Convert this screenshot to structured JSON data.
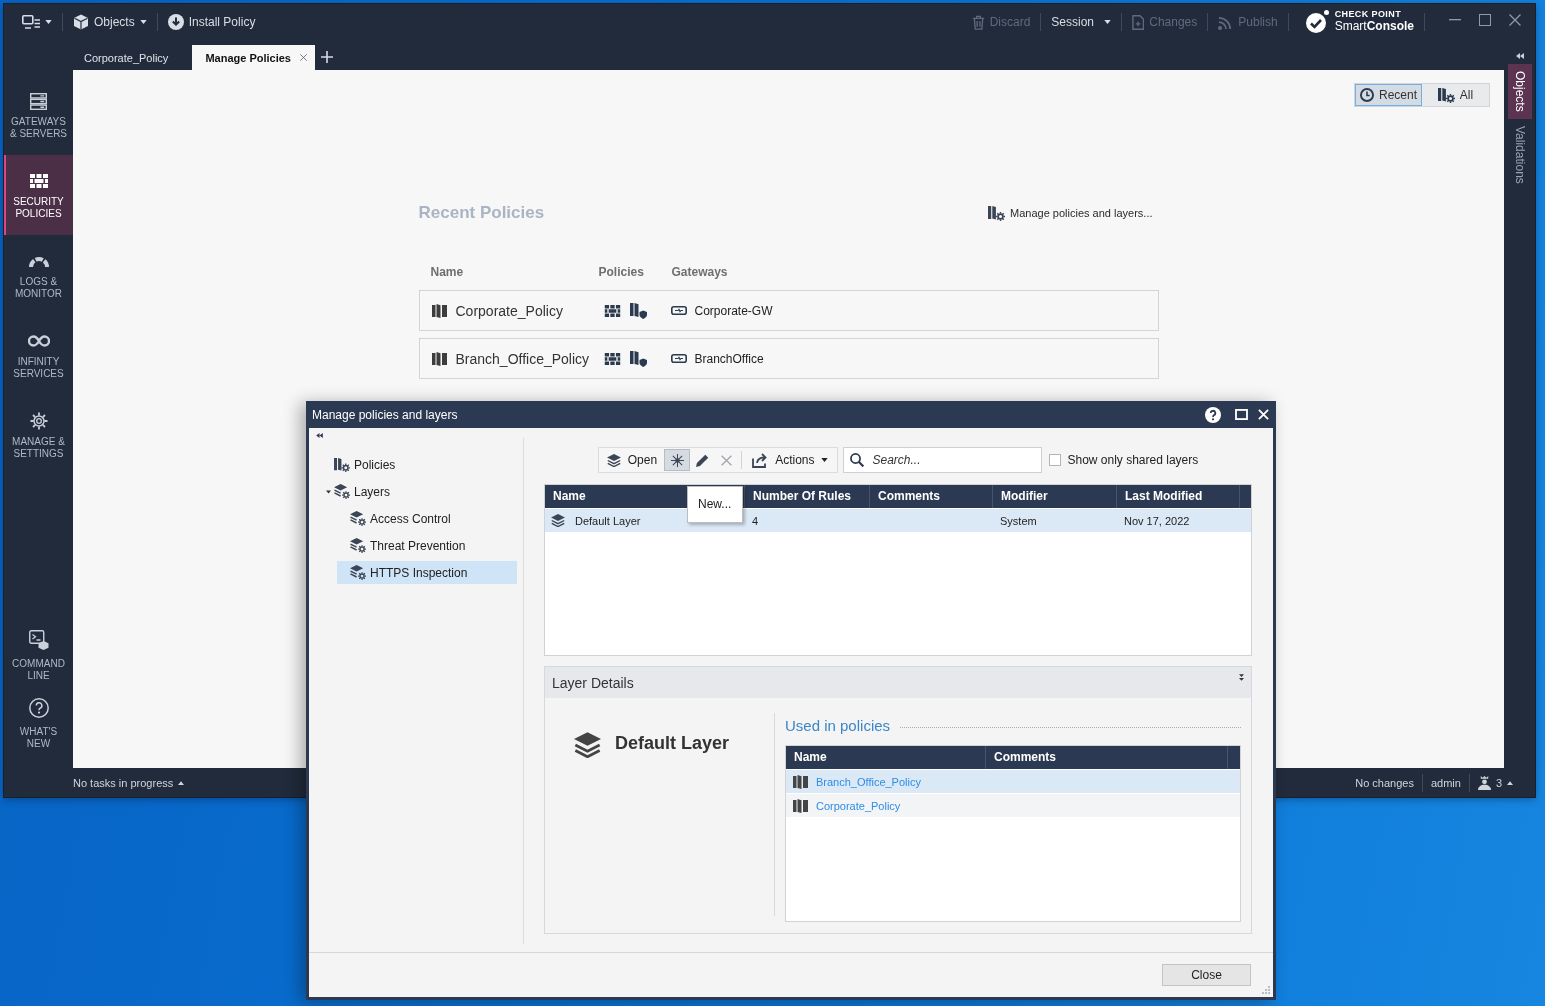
{
  "titlebar": {
    "menus": [
      {
        "kind": "objects",
        "label": "Objects"
      },
      {
        "kind": "install",
        "label": "Install Policy"
      }
    ],
    "actions": [
      {
        "kind": "discard",
        "label": "Discard",
        "disabled": true
      },
      {
        "kind": "session",
        "label": "Session",
        "disabled": false
      },
      {
        "kind": "changes",
        "label": "Changes",
        "disabled": true
      },
      {
        "kind": "publish",
        "label": "Publish",
        "disabled": true
      }
    ],
    "brand": {
      "company": "CHECK POINT",
      "product": "Smart**Console**"
    }
  },
  "tabs": [
    {
      "label": "Corporate_Policy",
      "selected": false,
      "closable": false
    },
    {
      "label": "Manage Policies",
      "selected": true,
      "closable": true
    }
  ],
  "sidebar": {
    "items": [
      {
        "kind": "gateways",
        "label": "GATEWAYS\n& SERVERS",
        "selected": false
      },
      {
        "kind": "policies",
        "label": "SECURITY\nPOLICIES",
        "selected": true
      },
      {
        "kind": "logs",
        "label": "LOGS &\nMONITOR",
        "selected": false
      },
      {
        "kind": "infinity",
        "label": "INFINITY\nSERVICES",
        "selected": false
      },
      {
        "kind": "manage",
        "label": "MANAGE &\nSETTINGS",
        "selected": false
      }
    ],
    "bottom_items": [
      {
        "kind": "command",
        "label": "COMMAND\nLINE",
        "selected": false
      },
      {
        "kind": "whats_new",
        "label": "WHAT'S\nNEW",
        "selected": false
      }
    ]
  },
  "main": {
    "view_toggle": [
      {
        "kind": "recent",
        "label": "Recent",
        "selected": true
      },
      {
        "kind": "all",
        "label": "All",
        "selected": false
      }
    ],
    "title": "Recent Policies",
    "manage_link": "Manage policies and layers...",
    "columns": [
      "Name",
      "Policies",
      "Gateways"
    ],
    "rows": [
      {
        "name": "Corporate_Policy",
        "gateway": "Corporate-GW"
      },
      {
        "name": "Branch_Office_Policy",
        "gateway": "BranchOffice"
      }
    ]
  },
  "right_panel": {
    "tabs": [
      {
        "label": "Objects",
        "selected": true
      },
      {
        "label": "Validations",
        "selected": false
      }
    ]
  },
  "status_bar": {
    "tasks": "No tasks in progress",
    "changes": "No changes",
    "user": "admin",
    "sessions": "3"
  },
  "dialog": {
    "title": "Manage policies and layers",
    "tree": [
      {
        "kind": "policies",
        "label": "Policies",
        "selected": false
      },
      {
        "kind": "layers",
        "label": "Layers",
        "selected": false,
        "expanded": true,
        "children": [
          {
            "kind": "layer",
            "label": "Access Control",
            "selected": false
          },
          {
            "kind": "layer",
            "label": "Threat Prevention",
            "selected": false
          },
          {
            "kind": "layer",
            "label": "HTTPS Inspection",
            "selected": true
          }
        ]
      }
    ],
    "toolbar": {
      "buttons": [
        {
          "kind": "open",
          "label": "Open",
          "pressed": false,
          "disabled": false
        },
        {
          "kind": "new",
          "pressed": true,
          "disabled": false,
          "tooltip": "New..."
        },
        {
          "kind": "edit",
          "pressed": false,
          "disabled": false
        },
        {
          "kind": "delete",
          "pressed": false,
          "disabled": true
        },
        {
          "kind": "actions",
          "label": "Actions",
          "pressed": false,
          "disabled": false
        }
      ],
      "search": {
        "placeholder": "Search..."
      },
      "shared_only": {
        "label": "Show only shared layers",
        "checked": false
      }
    },
    "table": {
      "columns": [
        "Name",
        "Number Of Rules",
        "Comments",
        "Modifier",
        "Last Modified"
      ],
      "rows": [
        {
          "name": "Default Layer",
          "rules": "4",
          "modifier": "System",
          "last_modified": "Nov 17, 2022",
          "selected": true
        }
      ]
    },
    "details": {
      "header": "Layer Details",
      "name": "Default Layer",
      "used_in": "Used in policies",
      "columns": [
        "Name",
        "Comments"
      ],
      "rows": [
        {
          "name": "Branch_Office_Policy",
          "selected": true
        },
        {
          "name": "Corporate_Policy",
          "selected": false
        }
      ]
    },
    "close": "Close"
  }
}
